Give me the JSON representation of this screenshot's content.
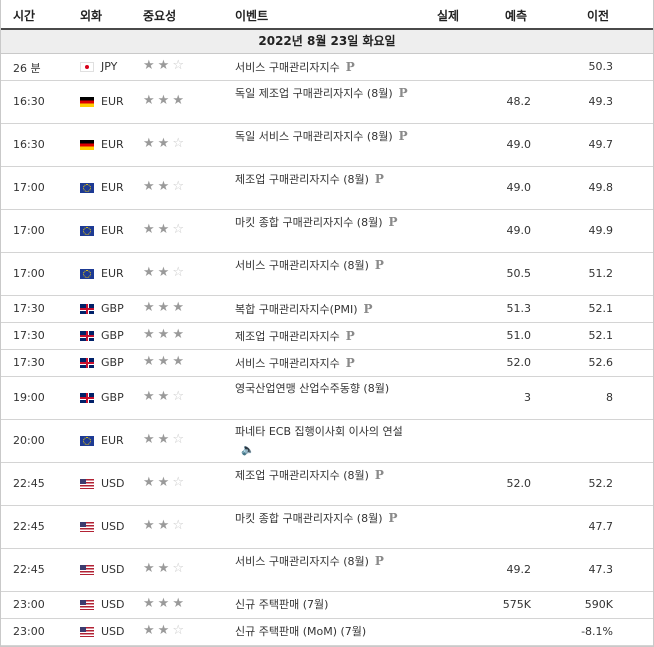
{
  "header": {
    "time": "시간",
    "currency": "외화",
    "importance": "중요성",
    "event": "이벤트",
    "actual": "실제",
    "forecast": "예측",
    "previous": "이전"
  },
  "date_label": "2022년 8월 23일 화요일",
  "icons": {
    "preliminary": "P",
    "speech": "speaker-icon"
  },
  "rows": [
    {
      "time": "26 분",
      "flag": "jp",
      "currency": "JPY",
      "stars": 2,
      "event": "서비스 구매관리자지수",
      "icon": "P",
      "forecast": "",
      "previous": "50.3",
      "tall": false
    },
    {
      "time": "16:30",
      "flag": "de",
      "currency": "EUR",
      "stars": 3,
      "event": "독일 제조업 구매관리자지수 (8월)",
      "icon": "P",
      "forecast": "48.2",
      "previous": "49.3",
      "tall": true
    },
    {
      "time": "16:30",
      "flag": "de",
      "currency": "EUR",
      "stars": 2,
      "event": "독일 서비스 구매관리자지수 (8월)",
      "icon": "P",
      "forecast": "49.0",
      "previous": "49.7",
      "tall": true
    },
    {
      "time": "17:00",
      "flag": "eu",
      "currency": "EUR",
      "stars": 2,
      "event": "제조업 구매관리자지수 (8월)",
      "icon": "P",
      "forecast": "49.0",
      "previous": "49.8",
      "tall": true
    },
    {
      "time": "17:00",
      "flag": "eu",
      "currency": "EUR",
      "stars": 2,
      "event": "마킷 종합 구매관리자지수 (8월)",
      "icon": "P",
      "forecast": "49.0",
      "previous": "49.9",
      "tall": true
    },
    {
      "time": "17:00",
      "flag": "eu",
      "currency": "EUR",
      "stars": 2,
      "event": "서비스 구매관리자지수 (8월)",
      "icon": "P",
      "forecast": "50.5",
      "previous": "51.2",
      "tall": true
    },
    {
      "time": "17:30",
      "flag": "gb",
      "currency": "GBP",
      "stars": 3,
      "event": "복합 구매관리자지수(PMI)",
      "icon": "P",
      "forecast": "51.3",
      "previous": "52.1",
      "tall": false
    },
    {
      "time": "17:30",
      "flag": "gb",
      "currency": "GBP",
      "stars": 3,
      "event": "제조업 구매관리자지수",
      "icon": "P",
      "forecast": "51.0",
      "previous": "52.1",
      "tall": false
    },
    {
      "time": "17:30",
      "flag": "gb",
      "currency": "GBP",
      "stars": 3,
      "event": "서비스 구매관리자지수",
      "icon": "P",
      "forecast": "52.0",
      "previous": "52.6",
      "tall": false
    },
    {
      "time": "19:00",
      "flag": "gb",
      "currency": "GBP",
      "stars": 2,
      "event": "영국산업연맹 산업수주동향 (8월)",
      "icon": "",
      "forecast": "3",
      "previous": "8",
      "tall": true
    },
    {
      "time": "20:00",
      "flag": "eu",
      "currency": "EUR",
      "stars": 2,
      "event": "파네타 ECB 집행이사회 이사의 연설",
      "icon": "speech",
      "forecast": "",
      "previous": "",
      "tall": true
    },
    {
      "time": "22:45",
      "flag": "us",
      "currency": "USD",
      "stars": 2,
      "event": "제조업 구매관리자지수 (8월)",
      "icon": "P",
      "forecast": "52.0",
      "previous": "52.2",
      "tall": true
    },
    {
      "time": "22:45",
      "flag": "us",
      "currency": "USD",
      "stars": 2,
      "event": "마킷 종합 구매관리자지수 (8월)",
      "icon": "P",
      "forecast": "",
      "previous": "47.7",
      "tall": true
    },
    {
      "time": "22:45",
      "flag": "us",
      "currency": "USD",
      "stars": 2,
      "event": "서비스 구매관리자지수 (8월)",
      "icon": "P",
      "forecast": "49.2",
      "previous": "47.3",
      "tall": true
    },
    {
      "time": "23:00",
      "flag": "us",
      "currency": "USD",
      "stars": 3,
      "event": "신규 주택판매 (7월)",
      "icon": "",
      "forecast": "575K",
      "previous": "590K",
      "tall": false
    },
    {
      "time": "23:00",
      "flag": "us",
      "currency": "USD",
      "stars": 2,
      "event": "신규 주택판매 (MoM) (7월)",
      "icon": "",
      "forecast": "",
      "previous": "-8.1%",
      "tall": false
    }
  ]
}
